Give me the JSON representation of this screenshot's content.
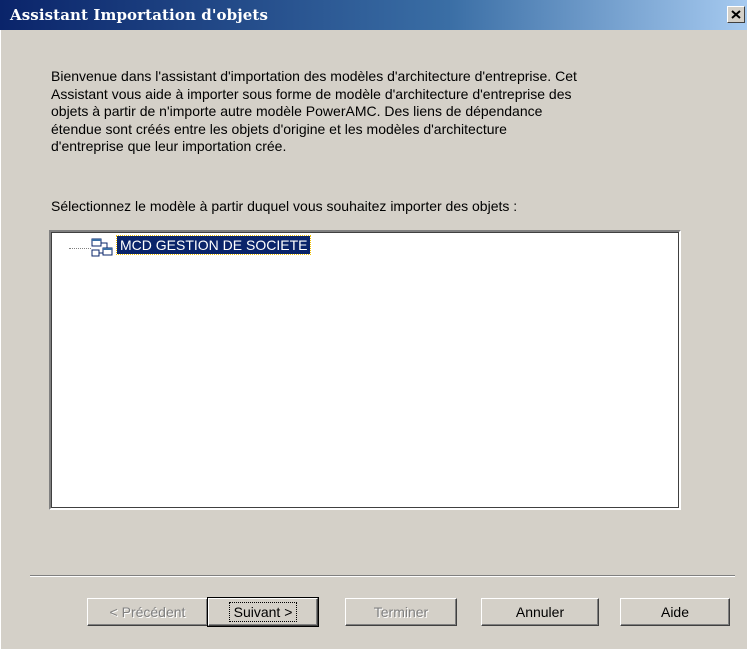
{
  "window": {
    "title": "Assistant Importation d'objets",
    "close_icon": "close-x-icon"
  },
  "intro": {
    "lines": [
      "Bienvenue dans l'assistant d'importation des modèles d'architecture d'entreprise. Cet",
      "Assistant vous aide à importer sous forme de modèle d'architecture d'entreprise des",
      "objets à partir de n'importe autre modèle PowerAMC. Des liens de dépendance",
      "étendue sont créés entre les objets d'origine et les modèles d'architecture",
      "d'entreprise que leur importation crée."
    ]
  },
  "prompt": "Sélectionnez le modèle à partir duquel vous souhaitez importer des objets :",
  "tree": {
    "items": [
      {
        "label": "MCD GESTION DE SOCIETE",
        "icon": "conceptual-model-icon",
        "selected": true
      }
    ]
  },
  "buttons": {
    "previous": {
      "label": "< Précédent",
      "enabled": false
    },
    "next": {
      "label": "Suivant >",
      "enabled": true,
      "default": true
    },
    "finish": {
      "label": "Terminer",
      "enabled": false
    },
    "cancel": {
      "label": "Annuler",
      "enabled": true
    },
    "help": {
      "label": "Aide",
      "enabled": true
    }
  },
  "colors": {
    "titlebar_start": "#0a246a",
    "titlebar_end": "#a6caf0",
    "dialog_bg": "#d4d0c8",
    "selection_bg": "#0a246a"
  }
}
